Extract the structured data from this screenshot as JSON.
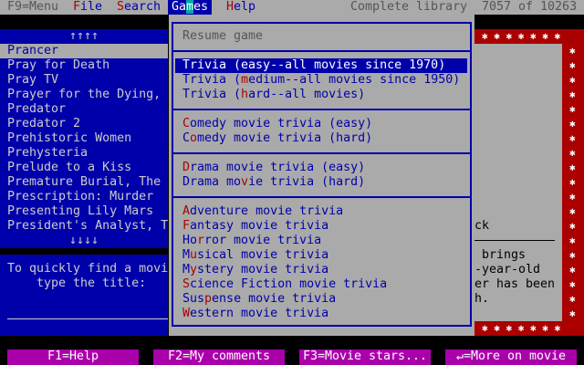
{
  "menubar": {
    "menu_key": "F9=Menu",
    "items": [
      {
        "hk": "F",
        "rest": "ile"
      },
      {
        "hk": "S",
        "rest": "earch"
      },
      {
        "pre": "Ga",
        "cur": "m",
        "post": "es"
      },
      {
        "hk": "H",
        "rest": "elp"
      }
    ],
    "library": "Complete library",
    "count": "7057 of 10263"
  },
  "list": {
    "up": "↑↑↑↑",
    "down": "↓↓↓↓",
    "items": [
      "Prancer",
      "Pray for Death",
      "Pray TV",
      "Prayer for the Dying,",
      "Predator",
      "Predator 2",
      "Prehistoric Women",
      "Prehysteria",
      "Prelude to a Kiss",
      "Premature Burial, The",
      "Prescription: Murder",
      "Presenting Lily Mars",
      "President's Analyst, T"
    ]
  },
  "search": {
    "line1": "To quickly find a movi",
    "line2": "type the title:"
  },
  "games_menu": {
    "resume": "Resume game",
    "items": [
      {
        "pre": "",
        "key": "",
        "post": "Trivia (easy--all movies since 1970)"
      },
      {
        "pre": "Trivia (",
        "key": "m",
        "post": "edium--all movies since 1950)"
      },
      {
        "pre": "Trivia (",
        "key": "h",
        "post": "ard--all movies)"
      },
      {
        "pre": "",
        "key": "C",
        "post": "omedy movie trivia (easy)"
      },
      {
        "pre": "C",
        "key": "o",
        "post": "medy movie trivia (hard)"
      },
      {
        "pre": "",
        "key": "D",
        "post": "rama movie trivia (easy)"
      },
      {
        "pre": "Drama mo",
        "key": "v",
        "post": "ie trivia (hard)"
      },
      {
        "pre": "",
        "key": "A",
        "post": "dventure movie trivia"
      },
      {
        "pre": "",
        "key": "F",
        "post": "antasy movie trivia"
      },
      {
        "pre": "Ho",
        "key": "r",
        "post": "ror movie trivia"
      },
      {
        "pre": "M",
        "key": "u",
        "post": "sical movie trivia"
      },
      {
        "pre": "M",
        "key": "y",
        "post": "stery movie trivia"
      },
      {
        "pre": "",
        "key": "S",
        "post": "cience Fiction movie trivia"
      },
      {
        "pre": "Sus",
        "key": "p",
        "post": "ense movie trivia"
      },
      {
        "pre": "",
        "key": "W",
        "post": "estern movie trivia"
      }
    ]
  },
  "detail": {
    "lines": [
      "ck",
      "",
      "brings",
      "-year-old",
      "er has been",
      "h."
    ]
  },
  "footer": {
    "f1": "F1=Help",
    "f2": "F2=My comments",
    "f3": "F3=Movie stars...",
    "enter": "↵=More on movie"
  }
}
